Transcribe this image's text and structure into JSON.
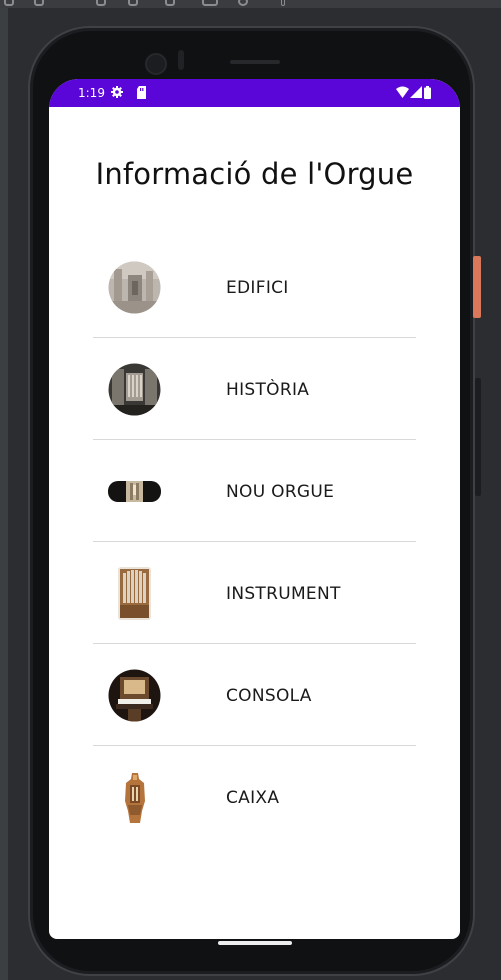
{
  "status_bar": {
    "time": "1:19",
    "background_color": "#5b06d8",
    "icons": [
      "gear-icon",
      "sd-card-icon",
      "wifi-icon",
      "signal-icon",
      "battery-icon"
    ]
  },
  "page": {
    "title": "Informació de l'Orgue"
  },
  "menu": {
    "items": [
      {
        "label": "EDIFICI",
        "icon": "building-facade-thumbnail"
      },
      {
        "label": "HISTÒRIA",
        "icon": "historic-organ-thumbnail"
      },
      {
        "label": "NOU ORGUE",
        "icon": "new-organ-thumbnail"
      },
      {
        "label": "INSTRUMENT",
        "icon": "organ-pipes-thumbnail"
      },
      {
        "label": "CONSOLA",
        "icon": "organ-console-thumbnail"
      },
      {
        "label": "CAIXA",
        "icon": "organ-case-thumbnail"
      }
    ]
  }
}
